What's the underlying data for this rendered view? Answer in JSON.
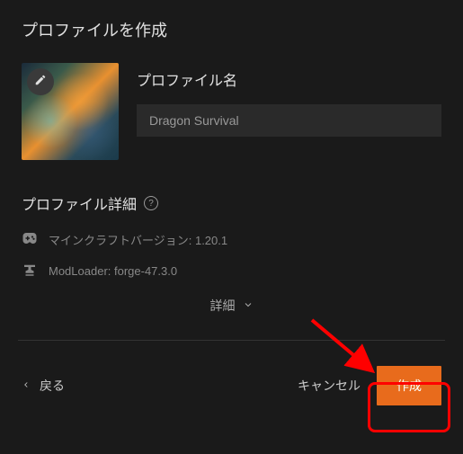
{
  "header": {
    "title": "プロファイルを作成"
  },
  "profile": {
    "name_label": "プロファイル名",
    "name_value": "Dragon Survival"
  },
  "details": {
    "section_title": "プロファイル詳細",
    "minecraft_version_label": "マインクラフトバージョン: 1.20.1",
    "modloader_label": "ModLoader: forge-47.3.0",
    "expand_label": "詳細"
  },
  "footer": {
    "back_label": "戻る",
    "cancel_label": "キャンセル",
    "create_label": "作成"
  }
}
